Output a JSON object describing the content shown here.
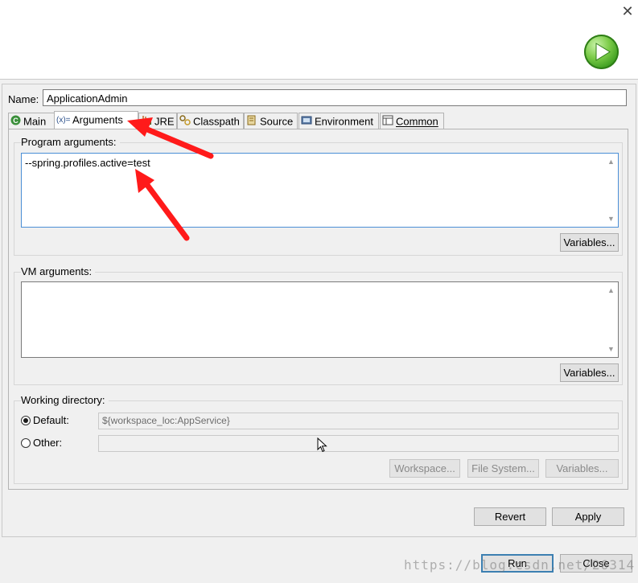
{
  "window": {
    "close_glyph": "✕"
  },
  "colors": {
    "annotation_arrow": "#ff1a1a",
    "run_logo": "#4caf2a",
    "focus_border": "#4b8fd6"
  },
  "name": {
    "label": "Name:",
    "mnemonic": "N",
    "value": "ApplicationAdmin"
  },
  "tabs": [
    {
      "label": "Main",
      "icon": "main-class-icon"
    },
    {
      "label": "Arguments",
      "icon": "arguments-icon",
      "active": true
    },
    {
      "label": "JRE",
      "icon": "jre-icon"
    },
    {
      "label": "Classpath",
      "icon": "classpath-icon"
    },
    {
      "label": "Source",
      "icon": "source-icon"
    },
    {
      "label": "Environment",
      "icon": "environment-icon"
    },
    {
      "label": "Common",
      "icon": "common-icon"
    }
  ],
  "program_arguments": {
    "title": "Program arguments:",
    "value": "--spring.profiles.active=test",
    "variables_button": "Variables..."
  },
  "vm_arguments": {
    "title": "VM arguments:",
    "value": "",
    "variables_button": "Variables..."
  },
  "working_directory": {
    "title": "Working directory:",
    "default_label": "Default:",
    "default_value": "${workspace_loc:AppService}",
    "other_label": "Other:",
    "other_value": "",
    "workspace_button": "Workspace...",
    "filesystem_button": "File System...",
    "variables_button": "Variables..."
  },
  "footer": {
    "revert": "Revert",
    "apply": "Apply",
    "run": "Run",
    "close": "Close"
  },
  "watermark": "https://blog.csdn.net/26314"
}
